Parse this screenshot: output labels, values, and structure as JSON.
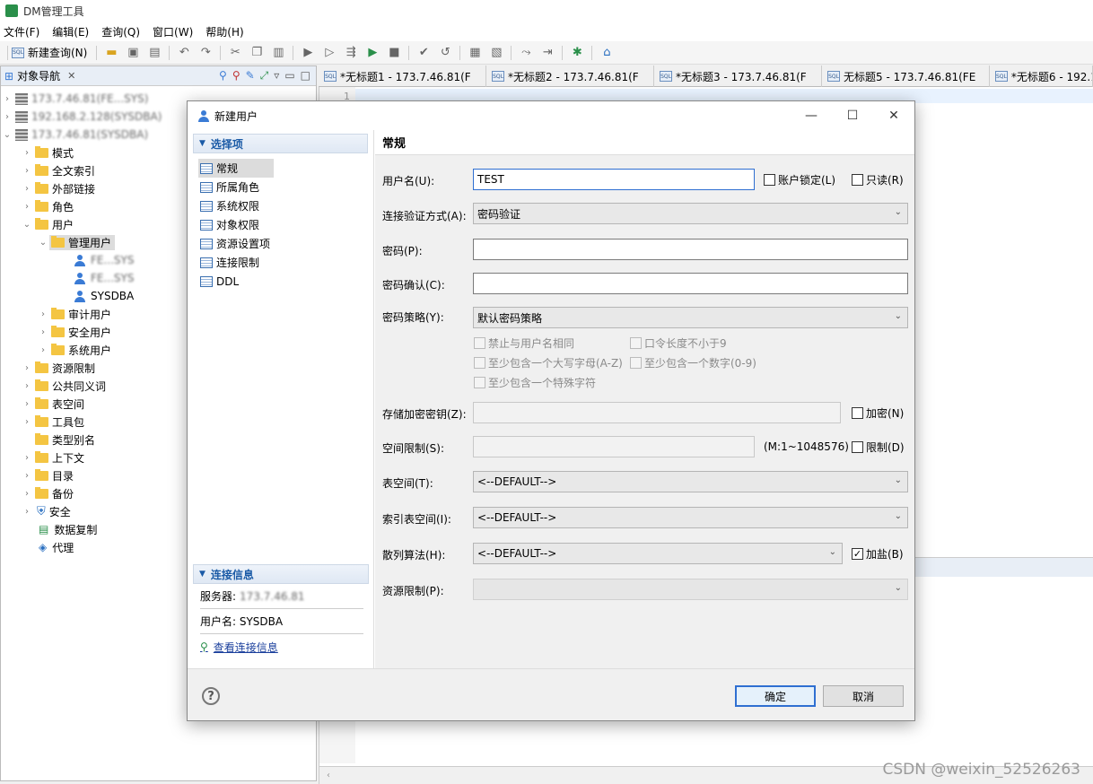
{
  "app": {
    "title": "DM管理工具"
  },
  "menu": [
    "文件(F)",
    "编辑(E)",
    "查询(Q)",
    "窗口(W)",
    "帮助(H)"
  ],
  "toolbar": {
    "new_query": "新建查询(N)"
  },
  "nav": {
    "title": "对象导航",
    "servers": [
      "173.7.46.81(FE...SYS)",
      "192.168.2.128(SYSDBA)",
      "173.7.46.81(SYSDBA)"
    ],
    "nodes": {
      "schema": "模式",
      "fulltext": "全文索引",
      "dblink": "外部链接",
      "role": "角色",
      "user": "用户",
      "admin_user": "管理用户",
      "admin_children": [
        "FE...SYS",
        "FE...SYS",
        "SYSDBA"
      ],
      "audit_user": "审计用户",
      "security_user": "安全用户",
      "system_user": "系统用户",
      "resource_limit": "资源限制",
      "synonym": "公共同义词",
      "tablespace": "表空间",
      "package": "工具包",
      "type_alias": "类型别名",
      "context": "上下文",
      "directory": "目录",
      "backup": "备份",
      "security": "安全",
      "replication": "数据复制",
      "proxy": "代理"
    }
  },
  "editor": {
    "tabs": [
      "*无标题1 - 173.7.46.81(F",
      "*无标题2 - 173.7.46.81(F",
      "*无标题3 - 173.7.46.81(F",
      "无标题5 - 173.7.46.81(FE",
      "*无标题6 - 192.1"
    ],
    "line_number": "1",
    "sql_icon": "SQL"
  },
  "watermark": "CSDN @weixin_52526263",
  "dialog": {
    "title": "新建用户",
    "left": {
      "section_options": "选择项",
      "options": [
        "常规",
        "所属角色",
        "系统权限",
        "对象权限",
        "资源设置项",
        "连接限制",
        "DDL"
      ],
      "section_conn": "连接信息",
      "server_label": "服务器:",
      "server_value": "173.7.46.81",
      "user_label": "用户名: SYSDBA",
      "view_link": "查看连接信息"
    },
    "right": {
      "heading": "常规",
      "username_label": "用户名(U):",
      "username_value": "TEST",
      "lock_label": "账户锁定(L)",
      "readonly_label": "只读(R)",
      "auth_label": "连接验证方式(A):",
      "auth_value": "密码验证",
      "password_label": "密码(P):",
      "password_confirm_label": "密码确认(C):",
      "policy_label": "密码策略(Y):",
      "policy_value": "默认密码策略",
      "policy_opts": [
        "禁止与用户名相同",
        "口令长度不小于9",
        "至少包含一个大写字母(A-Z)",
        "至少包含一个数字(0-9)",
        "至少包含一个特殊字符"
      ],
      "enc_key_label": "存储加密密钥(Z):",
      "encrypt_label": "加密(N)",
      "space_label": "空间限制(S):",
      "space_hint": "(M:1~1048576)",
      "limit_label": "限制(D)",
      "tablespace_label": "表空间(T):",
      "tablespace_value": "<--DEFAULT-->",
      "index_ts_label": "索引表空间(I):",
      "index_ts_value": "<--DEFAULT-->",
      "hash_label": "散列算法(H):",
      "hash_value": "<--DEFAULT-->",
      "salt_label": "加盐(B)",
      "res_limit_label": "资源限制(P):"
    },
    "buttons": {
      "ok": "确定",
      "cancel": "取消",
      "help": "?"
    }
  }
}
